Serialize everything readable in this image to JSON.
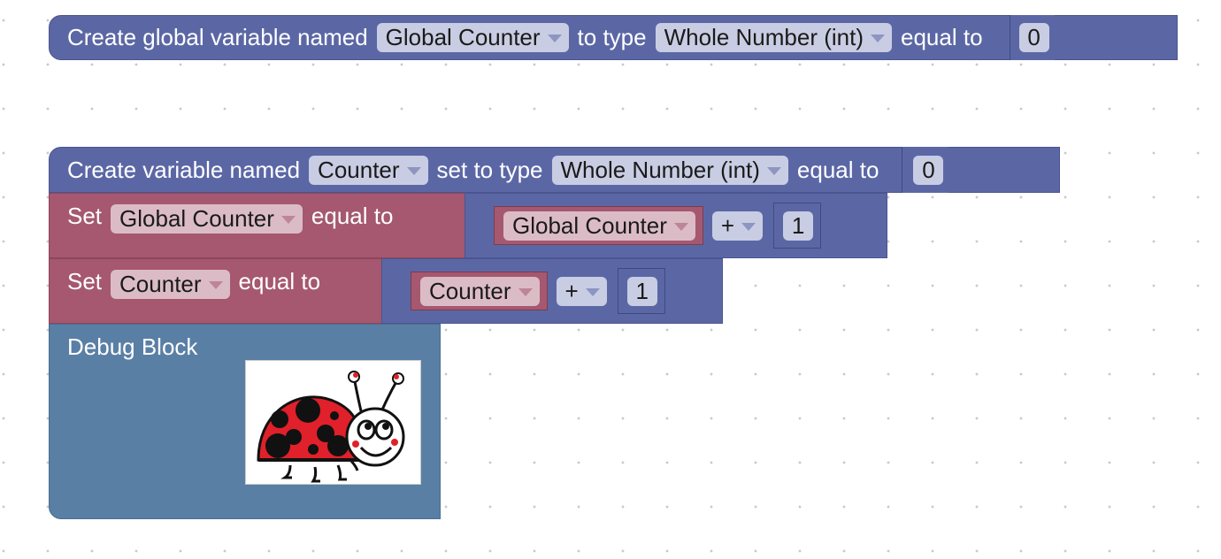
{
  "global_block": {
    "prefix": "Create global variable named",
    "name_value": "Global Counter",
    "type_label": "to type",
    "type_value": "Whole Number (int)",
    "equal_label": "equal to",
    "initial_value": "0"
  },
  "create_block": {
    "prefix": "Create variable named",
    "name_value": "Counter",
    "type_label": "set to type",
    "type_value": "Whole Number (int)",
    "equal_label": "equal to",
    "initial_value": "0"
  },
  "set_global_block": {
    "set_label": "Set",
    "var_value": "Global Counter",
    "equal_label": "equal to",
    "operand_var": "Global Counter",
    "operator": "+",
    "operand_num": "1"
  },
  "set_counter_block": {
    "set_label": "Set",
    "var_value": "Counter",
    "equal_label": "equal to",
    "operand_var": "Counter",
    "operator": "+",
    "operand_num": "1"
  },
  "debug_block": {
    "title": "Debug Block",
    "image_icon": "ladybug-icon"
  },
  "colors": {
    "variable_block": "#5b67a5",
    "set_block": "#a5586f",
    "debug_block": "#5a7fa5"
  }
}
